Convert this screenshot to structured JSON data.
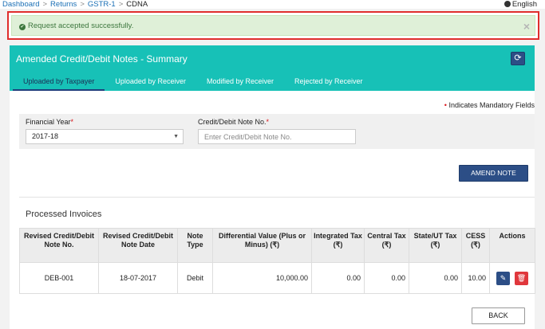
{
  "breadcrumb": {
    "items": [
      "Dashboard",
      "Returns",
      "GSTR-1"
    ],
    "current": "CDNA",
    "separator": ">"
  },
  "language": {
    "label": "English",
    "icon": "globe-icon"
  },
  "alert": {
    "message": "Request accepted successfully.",
    "close": "×",
    "icon": "check-circle-icon"
  },
  "panel": {
    "title": "Amended Credit/Debit Notes - Summary",
    "refresh_icon": "⟳",
    "tabs": [
      {
        "label": "Uploaded by Taxpayer",
        "active": true
      },
      {
        "label": "Uploaded by Receiver",
        "active": false
      },
      {
        "label": "Modified by Receiver",
        "active": false
      },
      {
        "label": "Rejected by Receiver",
        "active": false
      }
    ]
  },
  "mandatory_note": {
    "star": "•",
    "text": "Indicates Mandatory Fields"
  },
  "filters": {
    "financial_year": {
      "label": "Financial Year",
      "star": "*",
      "value": "2017-18"
    },
    "note_no": {
      "label": "Credit/Debit Note No.",
      "star": "*",
      "placeholder": "Enter Credit/Debit Note No.",
      "value": ""
    }
  },
  "actions": {
    "amend": "AMEND NOTE",
    "back": "BACK"
  },
  "processed": {
    "title": "Processed Invoices",
    "columns": [
      "Revised Credit/Debit Note No.",
      "Revised Credit/Debit Note Date",
      "Note Type",
      "Differential Value (Plus or Minus) (₹)",
      "Integrated Tax (₹)",
      "Central Tax (₹)",
      "State/UT Tax (₹)",
      "CESS (₹)",
      "Actions"
    ],
    "rows": [
      {
        "note_no": "DEB-001",
        "date": "18-07-2017",
        "type": "Debit",
        "diff_value": "10,000.00",
        "igst": "0.00",
        "cgst": "0.00",
        "sgst": "0.00",
        "cess": "10.00"
      }
    ]
  },
  "colors": {
    "header": "#17c1b7",
    "primary": "#2c4e86",
    "danger": "#e0373c",
    "alert_bg": "#dff0d8",
    "alert_text": "#3c763d",
    "highlight_border": "#e02d2d"
  }
}
